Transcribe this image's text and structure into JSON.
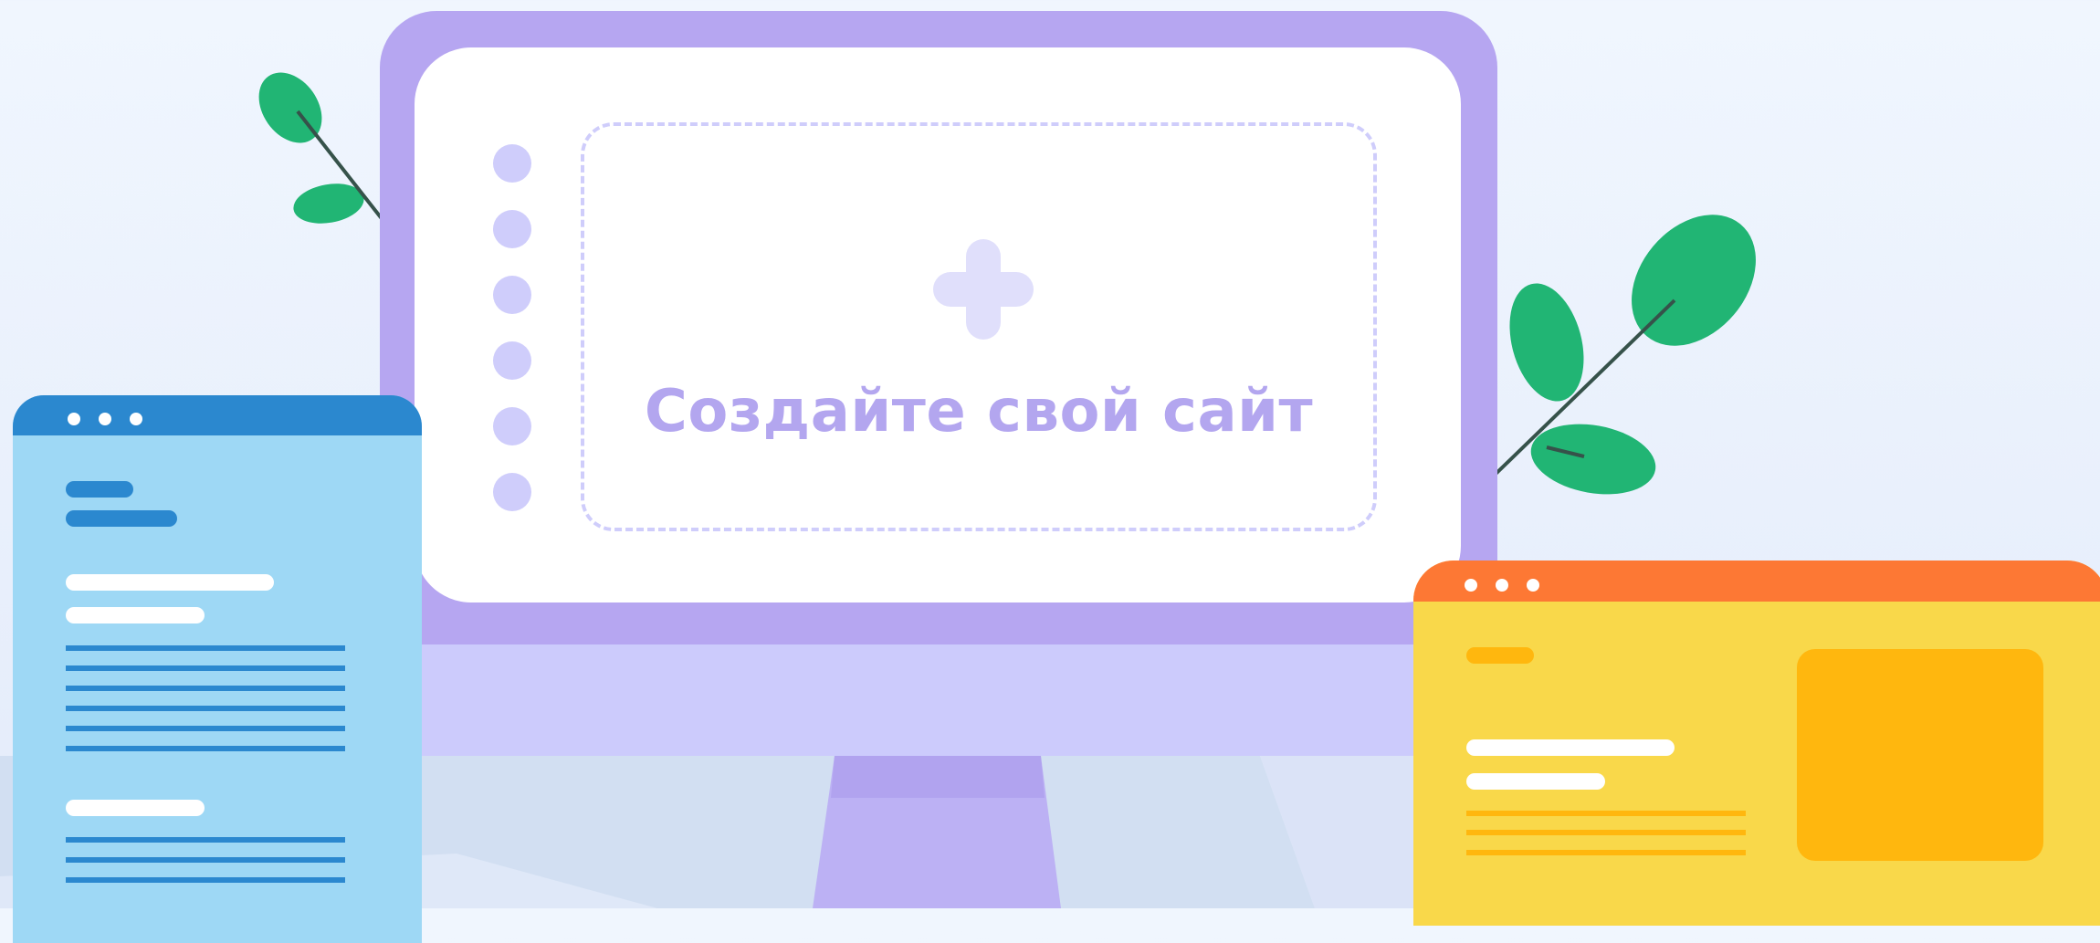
{
  "cta": {
    "label": "Создайте свой сайт",
    "icon": "plus-icon"
  },
  "colors": {
    "monitor_bezel": "#b6a6f1",
    "screen": "#ffffff",
    "accent_text": "#b3a6ef",
    "blue_window": "#9ed8f5",
    "blue_titlebar": "#2b88cf",
    "yellow_window": "#f9d84a",
    "orange_titlebar": "#fd7834",
    "leaf": "#21b574"
  }
}
